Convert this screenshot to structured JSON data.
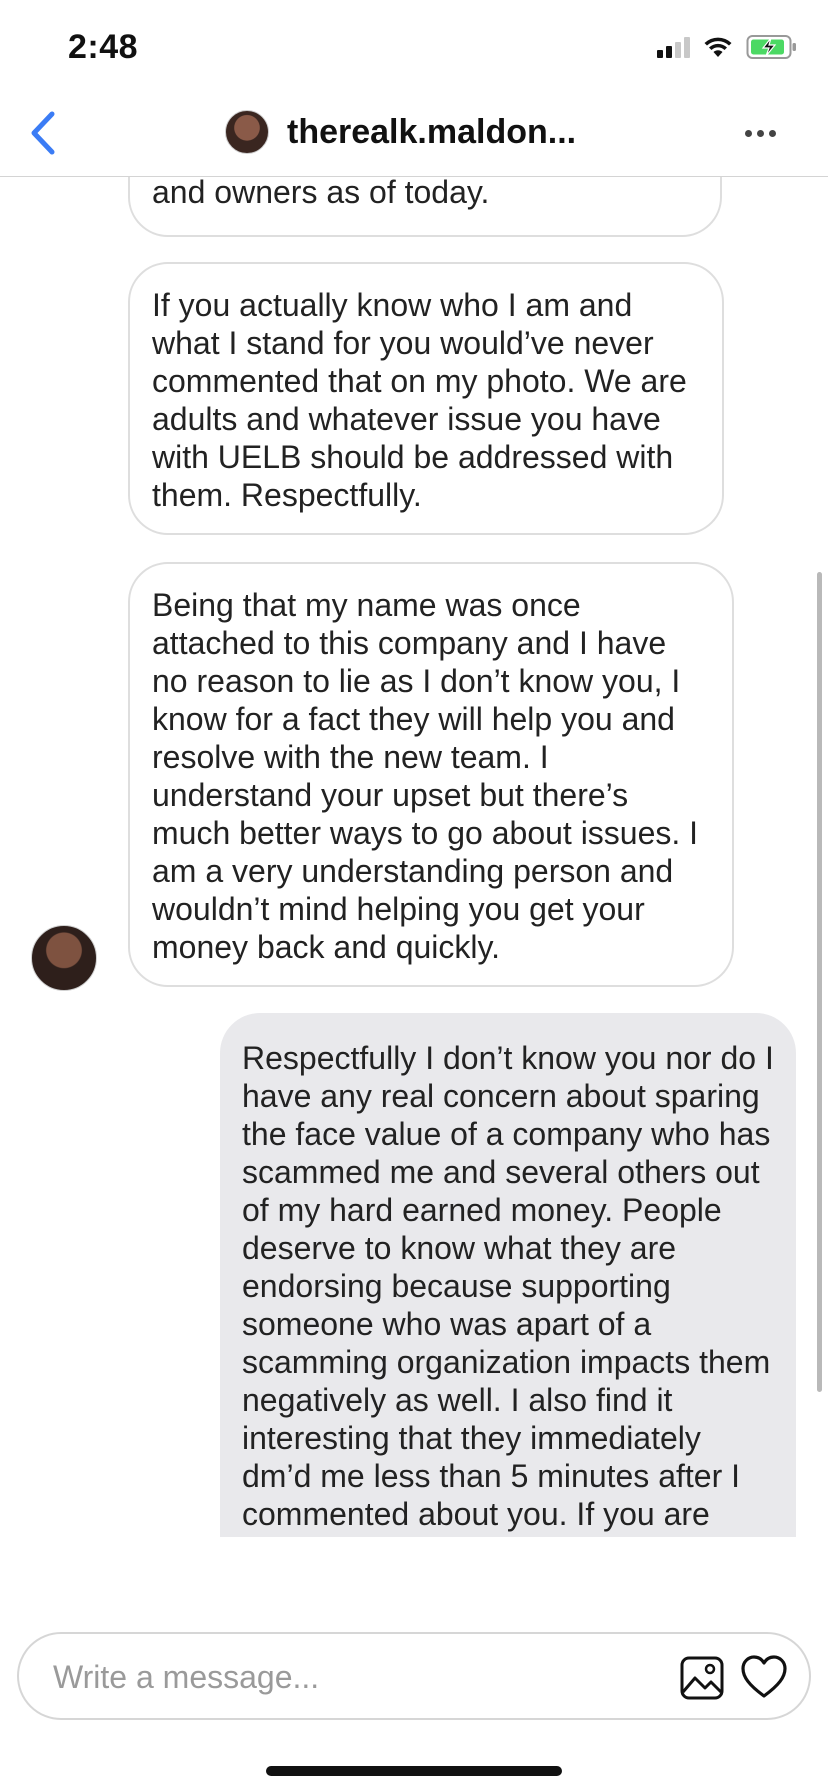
{
  "status_bar": {
    "time": "2:48"
  },
  "header": {
    "username": "therealk.maldon...",
    "back_icon": "chevron-left-icon",
    "more_icon": "ellipsis-icon",
    "back_color": "#3b7cf5"
  },
  "messages": [
    {
      "direction": "received",
      "text": "and owners as of today."
    },
    {
      "direction": "received",
      "text": "If you actually know who I am and what I stand for you would’ve never commented that on my photo. We are adults and whatever issue you have with UELB should be addressed with them. Respectfully."
    },
    {
      "direction": "received",
      "text": "Being that my name was once attached to this company and I have no reason to lie as I don’t know you, I know for a fact they will help you and resolve with the new team. I understand your upset but there’s much better ways to go about issues. I am a very understanding person and wouldn’t mind helping you get your money back and quickly."
    },
    {
      "direction": "sent",
      "text": "Respectfully I don’t know you nor do I have any real concern about sparing the face value of a company who has scammed me and several others out of my hard earned money.  People deserve to know what they are endorsing because supporting someone who was apart of a scamming organization impacts them negatively as well.  I also find it interesting that they immediately dm’d me less than 5 minutes after I commented about you.  If you are"
    }
  ],
  "composer": {
    "placeholder": "Write a message...",
    "value": "",
    "photo_icon": "image-icon",
    "like_icon": "heart-icon"
  },
  "colors": {
    "sent_bubble": "#e9e9ec",
    "received_border": "#dedede",
    "battery_fill": "#4cd964"
  }
}
